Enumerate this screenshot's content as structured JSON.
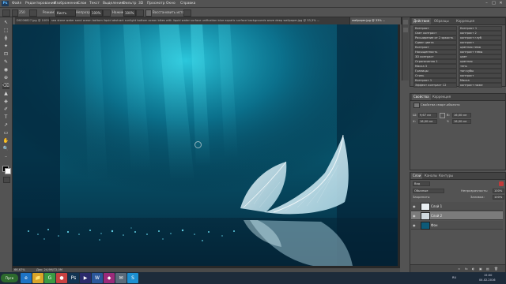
{
  "app": {
    "logo": "Ps"
  },
  "menu": [
    "Файл",
    "Редактирование",
    "Изображение",
    "Слои",
    "Текст",
    "Выделение",
    "Фильтр",
    "3D",
    "Просмотр",
    "Окно",
    "Справка"
  ],
  "window_controls": [
    "–",
    "□",
    "✕"
  ],
  "options": {
    "brush_size": "250",
    "mode_label": "Режим:",
    "mode_value": "Кисть",
    "opacity_label": "Непрозр.:",
    "opacity_value": "100%",
    "flow_label": "Нажим:",
    "flow_value": "100%",
    "restore_label": "Восстановить историю"
  },
  "tabs": [
    {
      "label": "DSC06827.jpg @ 100% (RGB/8)",
      "active": false
    },
    {
      "label": "sea stone water sand ocean bottom liquid abstract sunlight bottom ocean bikes with liquid water surface unification blue aquatic surface backgrounds wave deep wallpaper.jpg @ 33,3% ...",
      "active": false
    },
    {
      "label": "wallpaper.jpg @ 33% ...",
      "active": true
    }
  ],
  "tools": [
    "↖",
    "⬚",
    "ϕ",
    "✦",
    "⊡",
    "✎",
    "◉",
    "⊕",
    "⌫",
    "▲",
    "◈",
    "✐",
    "T",
    "↗",
    "▭",
    "✋",
    "🔍",
    "···"
  ],
  "canvas": {
    "sky_color": "#0a4a63",
    "glow_color": "#2fd4e8",
    "dark_color": "#021a2e"
  },
  "status": {
    "zoom": "66,67%",
    "doc": "Док: 24,9M/72,0M"
  },
  "adjust_panel": {
    "title": "Действия",
    "title2": "Образцы",
    "header_title": "Коррекция",
    "rows": [
      {
        "left": "Контраст",
        "right": "Контраст 1"
      },
      {
        "left": "Свет контраст",
        "right": "контраст 2"
      },
      {
        "left": "Расширение от 2 яркость",
        "right": "контраст глуб"
      },
      {
        "left": "Сдвиг цвета",
        "right": "контраст"
      },
      {
        "left": "Контраст",
        "right": "цветная тема"
      },
      {
        "left": "Насыщенность",
        "right": "контраст темы"
      },
      {
        "left": "3D контраст",
        "right": "цвет"
      },
      {
        "left": "Ограниченно 1",
        "right": "цветная"
      },
      {
        "left": "Маска 3",
        "right": "тень"
      },
      {
        "left": "Границы",
        "right": "тон кубы"
      },
      {
        "left": "Стиль",
        "right": "контраст"
      },
      {
        "left": "Контраст 1",
        "right": "Маска"
      },
      {
        "left": "Эффект контраст 12",
        "right": "контраст ниже"
      }
    ]
  },
  "properties_panel": {
    "tab1": "Свойства",
    "tab2": "Коррекция",
    "section": "Свойства смарт-объекта",
    "w_label": "Ш:",
    "w_value": "9,67 см",
    "h_label": "В:",
    "h_value": "16,00 см",
    "x_label": "X:",
    "x_value": "16,00 см",
    "y_label": "Y:",
    "y_value": "16,00 см"
  },
  "layers_panel": {
    "tabs": [
      "Слои",
      "Каналы",
      "Контуры"
    ],
    "filter_label": "Вид",
    "blend_mode": "Обычные",
    "opacity_label": "Непрозрачность:",
    "opacity_value": "100%",
    "lock_label": "Закрепить:",
    "fill_label": "Заливка:",
    "fill_value": "100%",
    "layers": [
      {
        "name": "Слой 1",
        "selected": false,
        "thumb": "#e9eef2"
      },
      {
        "name": "Слой 2",
        "selected": true,
        "thumb": "#cfd8de"
      },
      {
        "name": "Фон",
        "selected": false,
        "thumb": "#0d5a78"
      }
    ],
    "footer_icons": [
      "∞",
      "fx",
      "◐",
      "▣",
      "▤",
      "🗑"
    ]
  },
  "taskbar": {
    "start": "Пуск",
    "apps": [
      {
        "icon": "e",
        "color": "#1e73c4"
      },
      {
        "icon": "📁",
        "color": "#d9a528"
      },
      {
        "icon": "G",
        "color": "#3a9b43"
      },
      {
        "icon": "●",
        "color": "#c94141"
      },
      {
        "icon": "Ps",
        "color": "#123452"
      },
      {
        "icon": "▶",
        "color": "#2b2b6b"
      },
      {
        "icon": "W",
        "color": "#2b579a"
      },
      {
        "icon": "◆",
        "color": "#9b2a7a"
      },
      {
        "icon": "✉",
        "color": "#5a6a7a"
      },
      {
        "icon": "S",
        "color": "#1c8fd1"
      }
    ],
    "tray_lang": "RU",
    "time": "15:00",
    "date": "04.02.2016"
  }
}
